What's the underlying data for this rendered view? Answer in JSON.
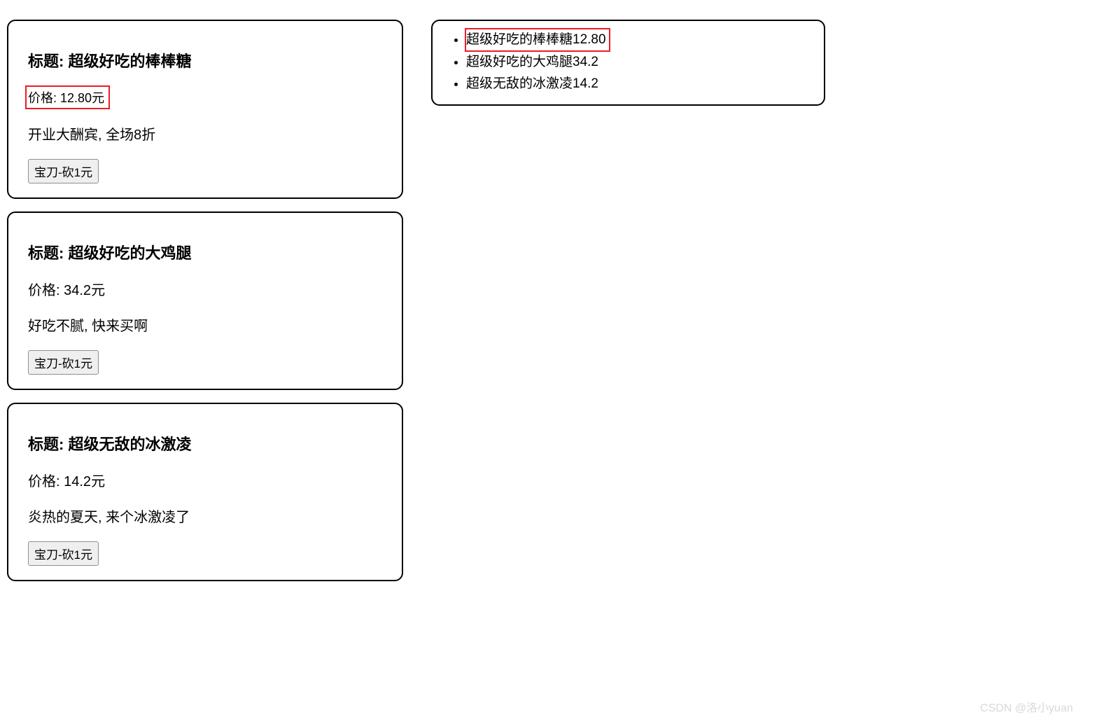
{
  "labels": {
    "title_prefix": "标题: ",
    "price_prefix": "价格: ",
    "price_suffix": "元",
    "button_label": "宝刀-砍1元"
  },
  "cards": [
    {
      "title": "超级好吃的棒棒糖",
      "price": "12.80",
      "desc": "开业大酬宾, 全场8折",
      "highlighted": true
    },
    {
      "title": "超级好吃的大鸡腿",
      "price": "34.2",
      "desc": "好吃不腻, 快来买啊",
      "highlighted": false
    },
    {
      "title": "超级无敌的冰激凌",
      "price": "14.2",
      "desc": "炎热的夏天, 来个冰激凌了",
      "highlighted": false
    }
  ],
  "summary_items": [
    {
      "text": "超级好吃的棒棒糖12.80",
      "highlighted": true
    },
    {
      "text": "超级好吃的大鸡腿34.2",
      "highlighted": false
    },
    {
      "text": "超级无敌的冰激凌14.2",
      "highlighted": false
    }
  ],
  "watermark": "CSDN @洛小yuan"
}
